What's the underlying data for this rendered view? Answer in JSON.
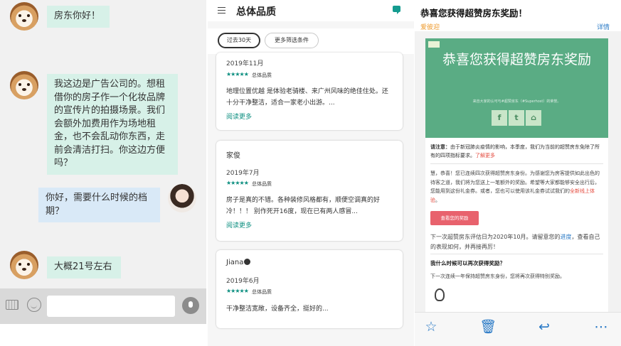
{
  "chat": {
    "messages": [
      {
        "sender": "other",
        "text": "房东你好！"
      },
      {
        "sender": "other",
        "text": "我这边是广告公司的。想租借你的房子作一个化妆品牌的宣传片的拍摄场景。我们会额外加费用作为场地租金，也不会乱动你东西，走前会清洁打扫。你这边方便吗？"
      },
      {
        "sender": "me",
        "text": "你好，需要什么时候的档期？"
      },
      {
        "sender": "other",
        "text": "大概21号左右"
      }
    ]
  },
  "reviews": {
    "title": "总体品质",
    "filters": {
      "past": "过去30天",
      "more": "更多筛选条件"
    },
    "stars": "★★★★★",
    "stars_label": "总体品质",
    "read_more": "阅读更多",
    "cards": [
      {
        "name": "",
        "date": "2019年11月",
        "text": "地理位置优越 是体验老骑楼、来广州风味的绝佳住处。还十分干净整洁，适合一家老小出游。..."
      },
      {
        "name": "家俊",
        "date": "2019年7月",
        "text": "房子是真的不错。各种装修风格都有，顺便空调真的好冷！！！ 别作死开16度，现在已有两人感冒..."
      },
      {
        "name": "Jiana",
        "date": "2019年6月",
        "text": "干净整洁宽敞，设备齐全，挺好的..."
      }
    ]
  },
  "email": {
    "subject": "恭喜您获得超赞房东奖励！",
    "sender": "爱彼迎",
    "details": "详情",
    "hero_title": "恭喜您获得超赞房东奖励",
    "hero_sub": "来自大家的认可与#超赞房东（#Superhost）的荣誉。",
    "social": {
      "facebook": "f",
      "twitter": "t"
    },
    "notice_label": "请注意：",
    "notice_text": "由于新冠肺炎疫情的影响，本季度，我们为当前的超赞房东免除了所有的四项指标要求。",
    "notice_link": "了解更多",
    "body_text": "慧，恭喜！您已连续四次获得超赞房东身份。为感谢您为房客提供如此出色的待客之道，我们将为您送上一笔额外的奖励。希望等大家都能够安全出行后，您能用到这份礼金券。或者，您也可以使用该礼金券试试我们的",
    "body_link": "全新线上体验",
    "button": "查看您的奖励",
    "next_text": "下一次超赞房东评估日为2020年10月。请留意您的",
    "next_link": "进度",
    "next_tail": "，查看自己的表现如何，并再接再厉！",
    "question": "我什么时候可以再次获得奖励？",
    "answer": "下一次连续一年保持超赞房东身份，您将再次获得特别奖励。"
  }
}
